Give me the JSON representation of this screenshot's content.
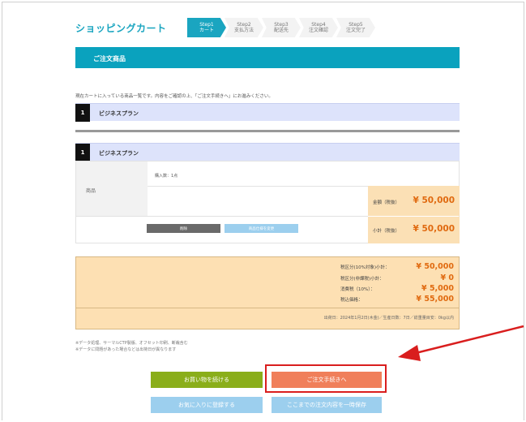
{
  "header": {
    "title": "ショッピングカート",
    "steps": [
      {
        "step": "Step1",
        "label": "カート",
        "active": true
      },
      {
        "step": "Step2",
        "label": "支払方法",
        "active": false
      },
      {
        "step": "Step3",
        "label": "配送先",
        "active": false
      },
      {
        "step": "Step4",
        "label": "注文確認",
        "active": false
      },
      {
        "step": "Step5",
        "label": "注文完了",
        "active": false
      }
    ]
  },
  "section": {
    "title": "ご注文商品",
    "notice": "現在カートに入っている商品一覧です。内容をご確認の上、「ご注文手続きへ」にお進みください。"
  },
  "plan_summary": {
    "number": "1",
    "name": "ビジネスプラン"
  },
  "item": {
    "number": "1",
    "name": "ビジネスプラン",
    "product_label": "商品",
    "quantity": "購入数：1点",
    "amount_label": "金額（税抜）",
    "amount": "¥ 50,000",
    "subtotal_label": "小計（税抜）",
    "subtotal": "¥ 50,000",
    "delete_label": "削除",
    "change_label": "商品仕様を変更"
  },
  "summary": {
    "rows": [
      {
        "label": "税区分(10%対象)小計：",
        "value": "¥ 50,000"
      },
      {
        "label": "税区分(非課税)小計：",
        "value": "¥ 0"
      },
      {
        "label": "消費税（10%）：",
        "value": "¥ 5,000"
      },
      {
        "label": "税込価格：",
        "value": "¥ 55,000"
      }
    ],
    "shipping": "出荷日：2024年1月2日(木金)／生産日数：7日／総重量目安：0kg以内"
  },
  "notes": [
    "※データ処理、サーマルCTP製版、オフセット印刷、断裁含む",
    "※データに問題があった場合などは出荷日が異なります"
  ],
  "buttons": {
    "continue_shopping": "お買い物を続ける",
    "checkout": "ご注文手続きへ",
    "favorite": "お気に入りに登録する",
    "save_order": "ここまでの注文内容を一時保存"
  },
  "colors": {
    "accent": "#1aa5c0",
    "price": "#e06a10",
    "highlight": "#d91e1e",
    "continue_button": "#8aae1a",
    "checkout_button": "#f07f5a",
    "secondary_button": "#9ccfee"
  }
}
